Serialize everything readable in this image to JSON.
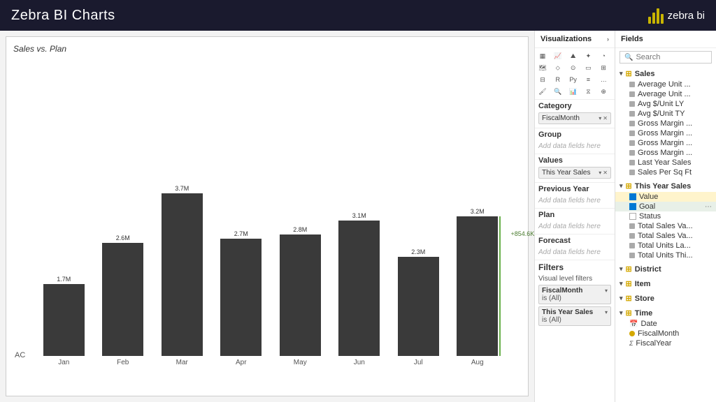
{
  "topbar": {
    "title": "Zebra BI Charts",
    "logo_text": "zebra bi"
  },
  "chart": {
    "title": "Sales vs. Plan",
    "y_label": "AC",
    "bars": [
      {
        "label": "Jan",
        "value": "1.7M",
        "height_pct": 32
      },
      {
        "label": "Feb",
        "value": "2.6M",
        "height_pct": 50
      },
      {
        "label": "Mar",
        "value": "3.7M",
        "height_pct": 72
      },
      {
        "label": "Apr",
        "value": "2.7M",
        "height_pct": 52
      },
      {
        "label": "May",
        "value": "2.8M",
        "height_pct": 54
      },
      {
        "label": "Jun",
        "value": "3.1M",
        "height_pct": 60
      },
      {
        "label": "Jul",
        "value": "2.3M",
        "height_pct": 44
      },
      {
        "label": "Aug",
        "value": "3.2M",
        "height_pct": 62,
        "delta": "+854.6K"
      }
    ]
  },
  "visualizations": {
    "header": "Visualizations",
    "chevron": "›"
  },
  "fields": {
    "header": "Fields",
    "search_placeholder": "Search"
  },
  "data_config": {
    "category_label": "Category",
    "category_value": "FiscalMonth",
    "group_label": "Group",
    "group_placeholder": "Add data fields here",
    "values_label": "Values",
    "values_value": "This Year Sales",
    "prev_year_label": "Previous Year",
    "prev_year_placeholder": "Add data fields here",
    "plan_label": "Plan",
    "plan_placeholder": "Add data fields here",
    "forecast_label": "Forecast",
    "forecast_placeholder": "Add data fields here",
    "filters_label": "Filters",
    "visual_filters_label": "Visual level filters",
    "filter1_label": "FiscalMonth",
    "filter1_value": "is (All)",
    "filter2_label": "This Year Sales",
    "filter2_value": "is (All)"
  },
  "field_tree": {
    "sales_section": "Sales",
    "sales_items": [
      "Average Unit ...",
      "Average Unit ...",
      "Avg $/Unit LY",
      "Avg $/Unit TY",
      "Gross Margin ...",
      "Gross Margin ...",
      "Gross Margin ...",
      "Gross Margin ...",
      "Last Year Sales",
      "Sales Per Sq Ft"
    ],
    "this_year_sales_section": "This Year Sales",
    "this_year_items": [
      {
        "name": "Value",
        "checked": true
      },
      {
        "name": "Goal",
        "checked": true
      },
      {
        "name": "Status",
        "checked": false
      }
    ],
    "other_items": [
      "Total Sales Va...",
      "Total Sales Va...",
      "Total Units La...",
      "Total Units Thi..."
    ],
    "section2": "District",
    "section3": "Item",
    "section4": "Store",
    "section5": "Time",
    "time_items": [
      {
        "name": "Date",
        "type": "calendar"
      },
      {
        "name": "FiscalMonth",
        "type": "dot-yellow"
      },
      {
        "name": "FiscalYear",
        "type": "sigma"
      }
    ]
  }
}
